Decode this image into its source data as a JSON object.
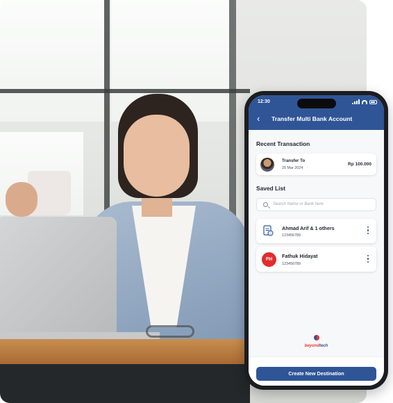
{
  "status_bar": {
    "time": "12:30"
  },
  "app_bar": {
    "title": "Transfer Multi Bank Account",
    "back_icon": "back-arrow-icon"
  },
  "recent": {
    "heading": "Recent Transaction",
    "item": {
      "title": "Transfer To",
      "date": "25 Mar 2024",
      "amount": "Rp 100.000"
    }
  },
  "saved": {
    "heading": "Saved List",
    "search_placeholder": "Search Name or Bank here",
    "items": [
      {
        "name": "Ahmad Arif & 1 others",
        "account": "123456789",
        "icon": "bank-document-icon"
      },
      {
        "name": "Fathuk Hidayat",
        "account": "123456789",
        "initials": "FH"
      }
    ]
  },
  "brand": {
    "part1": "beyond",
    "part2": "tech"
  },
  "cta": {
    "label": "Create New Destination"
  },
  "colors": {
    "primary": "#2f5597",
    "avatar_red": "#e32b2b",
    "background": "#f7f8fa"
  }
}
